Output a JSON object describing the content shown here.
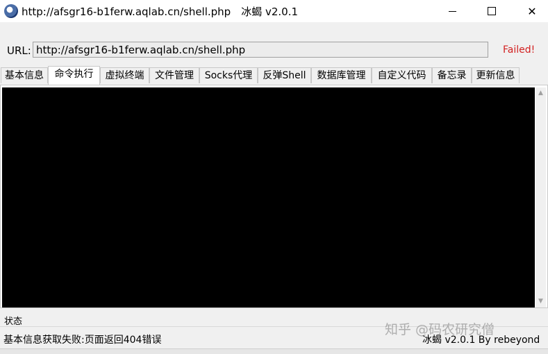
{
  "window": {
    "title": "http://afsgr16-b1ferw.aqlab.cn/shell.php　冰蝎 v2.0.1",
    "minimize_glyph": "",
    "maximize_glyph": "",
    "close_glyph": "✕"
  },
  "url_bar": {
    "label": "URL:",
    "value": "http://afsgr16-b1ferw.aqlab.cn/shell.php",
    "status": "Failed!",
    "status_color": "#d21f1f"
  },
  "tabs": [
    {
      "label": "基本信息"
    },
    {
      "label": "命令执行"
    },
    {
      "label": "虚拟终端"
    },
    {
      "label": "文件管理"
    },
    {
      "label": "Socks代理"
    },
    {
      "label": "反弹Shell"
    },
    {
      "label": "数据库管理"
    },
    {
      "label": "自定义代码"
    },
    {
      "label": "备忘录"
    },
    {
      "label": "更新信息"
    }
  ],
  "active_tab": "命令执行",
  "console": {
    "background": "#000000"
  },
  "scrollbar": {
    "up": "▲",
    "down": "▼"
  },
  "status": {
    "label": "状态",
    "message": "基本信息获取失败:页面返回404错误",
    "version": "冰蝎 v2.0.1 By rebeyond"
  },
  "watermark": "知乎 @码农研究僧"
}
